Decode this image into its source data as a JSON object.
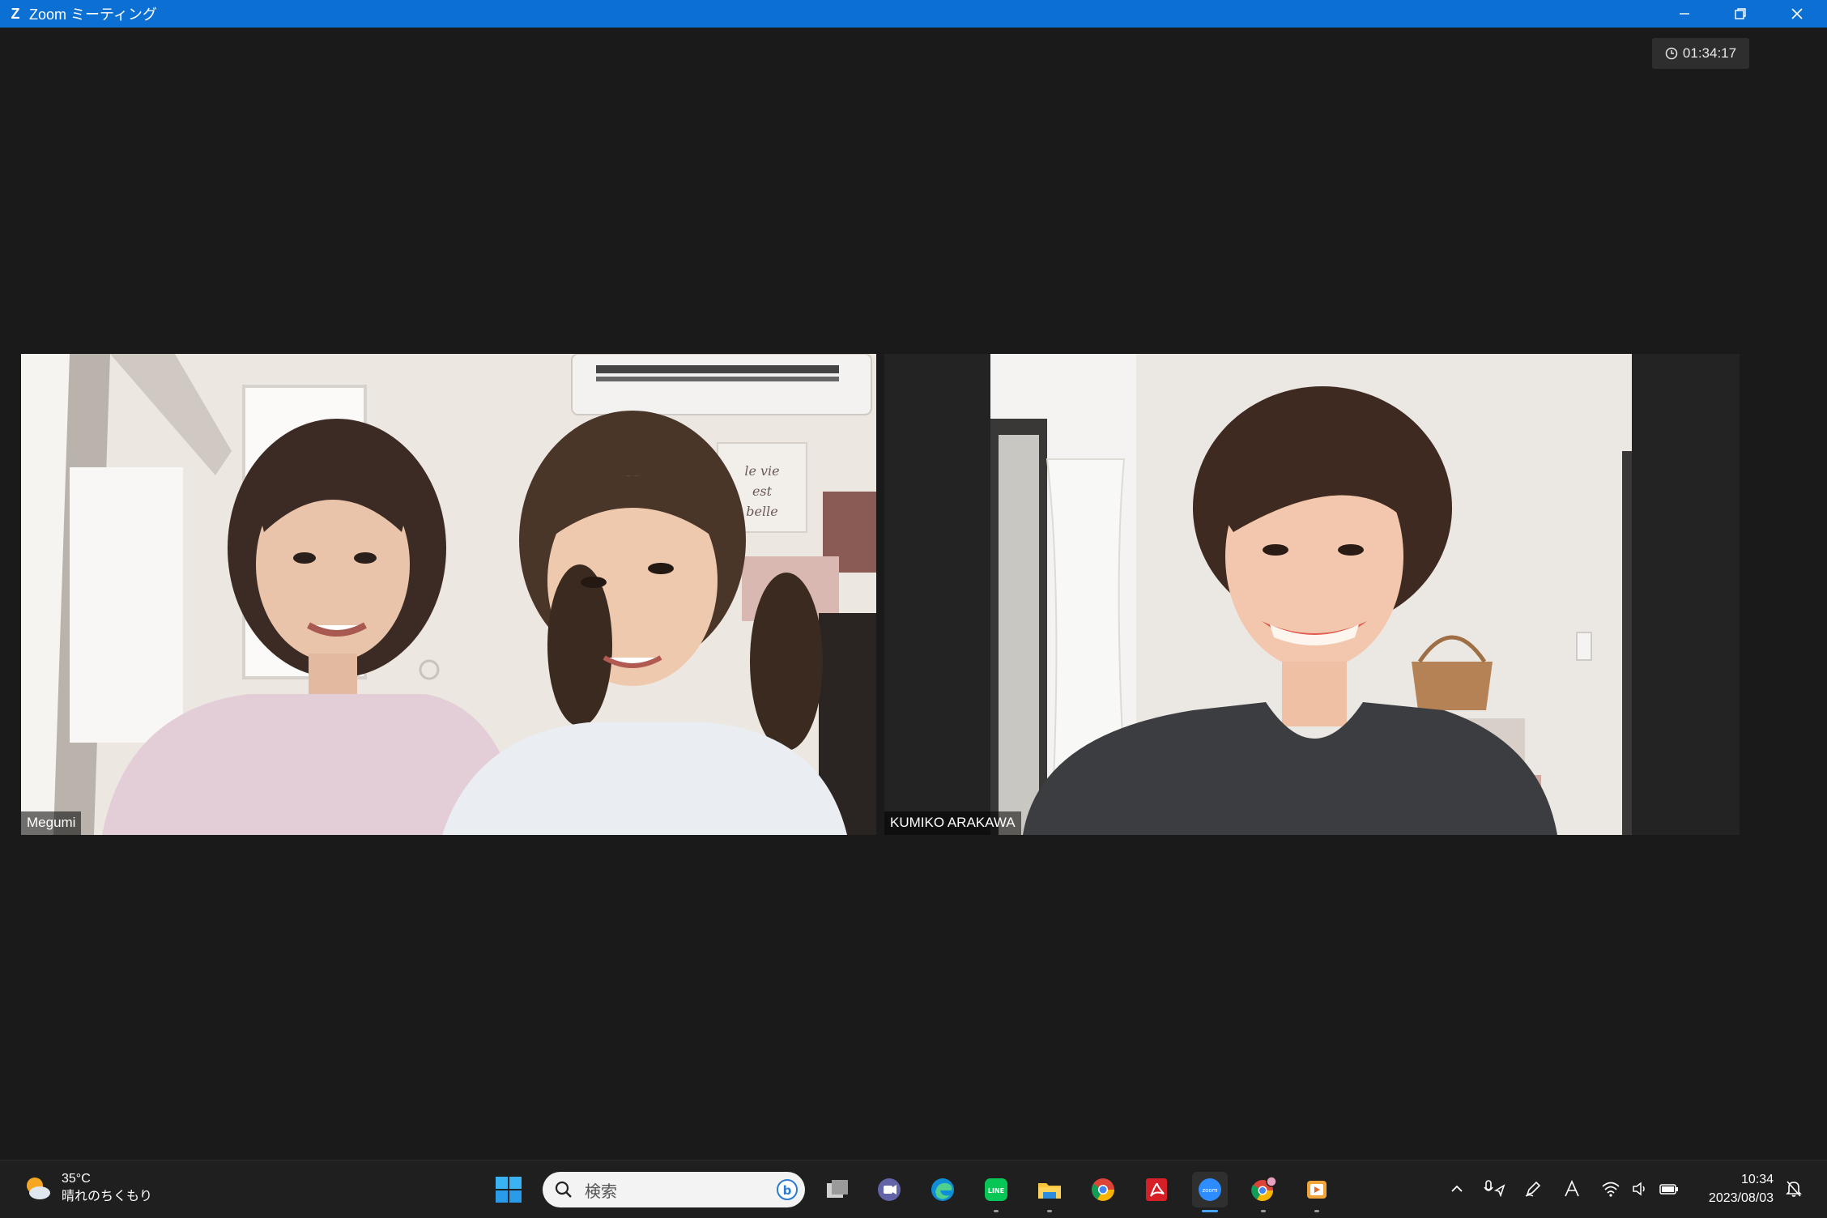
{
  "window": {
    "title": "Zoom ミーティング",
    "logo_letter": "Z"
  },
  "meeting": {
    "elapsed": "01:34:17",
    "participants": [
      {
        "name": "Megumi"
      },
      {
        "name": "KUMIKO ARAKAWA"
      }
    ]
  },
  "taskbar": {
    "weather": {
      "temp": "35°C",
      "condition": "晴れのちくもり"
    },
    "search_placeholder": "検索",
    "pinned_apps": [
      "task-view",
      "teams-chat",
      "edge",
      "line",
      "file-explorer",
      "chrome",
      "acrobat",
      "zoom",
      "chrome-profile",
      "media-player"
    ],
    "clock": {
      "time": "10:34",
      "date": "2023/08/03"
    }
  },
  "colors": {
    "titlebar": "#0b6fd3",
    "stage": "#1a1a1a",
    "taskbar": "#1f1f1f",
    "accent": "#4aa3ff"
  }
}
